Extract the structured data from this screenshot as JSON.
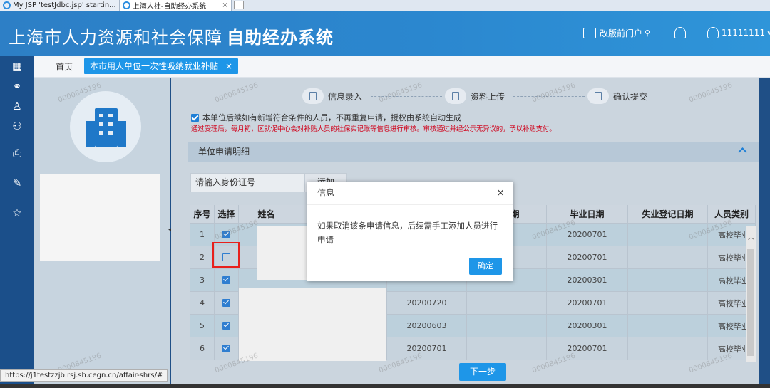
{
  "browser": {
    "tabs": [
      {
        "label": "My JSP 'testJdbc.jsp' startin..."
      },
      {
        "label": "上海人社-自助经办系统",
        "close": "×"
      }
    ],
    "status_url": "https://j1testzzjb.rsj.sh.cegn.cn/affair-shrs/#"
  },
  "header": {
    "title_light": "上海市人力资源和社会保障",
    "title_bold": "自助经办系统",
    "portal_link": "改版前门户",
    "user_id": "11111111"
  },
  "tabsbar": {
    "home": "首页",
    "active_tab": "本市用人单位一次性吸纳就业补贴",
    "close": "×"
  },
  "steps": [
    {
      "label": "信息录入"
    },
    {
      "label": "资料上传"
    },
    {
      "label": "确认提交"
    }
  ],
  "notice": {
    "check_text": "本单位后续如有新增符合条件的人员，不再重复申请，授权由系统自动生成",
    "red_text": "通过受理后，每月初，区就促中心会对补贴人员的社保实记账等信息进行审核。审核通过并经公示无异议的，予以补贴支付。"
  },
  "section": {
    "title": "单位申请明细"
  },
  "search": {
    "placeholder": "请输入身份证号",
    "add_button": "添加"
  },
  "table": {
    "headers": [
      "序号",
      "选择",
      "姓名",
      "",
      "",
      "录日期",
      "毕业日期",
      "失业登记日期",
      "人员类别"
    ],
    "rows": [
      {
        "no": "1",
        "checked": true,
        "d1": "",
        "grad": "20200701",
        "cat": "高校毕业"
      },
      {
        "no": "2",
        "checked": false,
        "d1": "",
        "grad": "20200701",
        "cat": "高校毕业"
      },
      {
        "no": "3",
        "checked": true,
        "d1": "",
        "grad": "20200301",
        "cat": "高校毕业"
      },
      {
        "no": "4",
        "checked": true,
        "d1": "20200720",
        "grad": "20200701",
        "cat": "高校毕业"
      },
      {
        "no": "5",
        "checked": true,
        "d1": "20200603",
        "grad": "20200301",
        "cat": "高校毕业"
      },
      {
        "no": "6",
        "checked": true,
        "d1": "20200701",
        "grad": "20200701",
        "cat": "高校毕业"
      }
    ]
  },
  "next_button": "下一步",
  "modal": {
    "title": "信息",
    "close": "×",
    "message": "如果取消该条申请信息，后续需手工添加人员进行申请",
    "ok": "确定"
  },
  "watermark": "0000845196",
  "colors": {
    "primary": "#1e96e8",
    "header": "#2b87cf",
    "rail": "#1b4f8a",
    "warning": "#d0021b"
  }
}
